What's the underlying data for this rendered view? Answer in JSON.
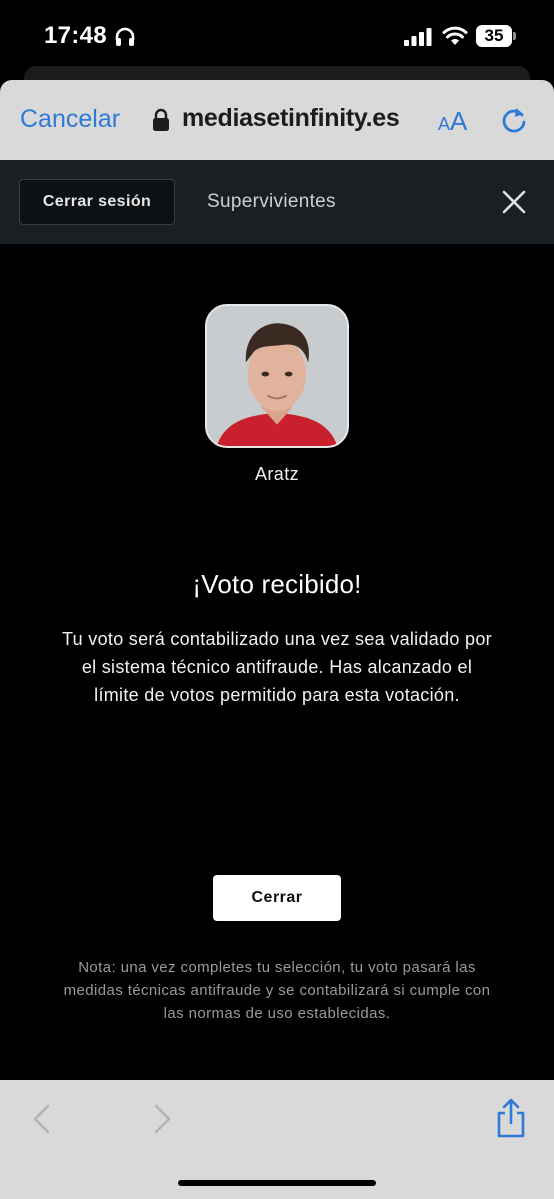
{
  "status_bar": {
    "time": "17:48",
    "battery": "35",
    "icons": [
      "headphones-icon",
      "cellular-signal-icon",
      "wifi-icon",
      "battery-icon"
    ]
  },
  "browser": {
    "cancel_label": "Cancelar",
    "url": "mediasetinfinity.es",
    "text_size_small": "A",
    "text_size_big": "A",
    "icons": [
      "lock-icon",
      "reload-icon",
      "back-icon",
      "forward-icon",
      "share-icon"
    ]
  },
  "topbar": {
    "logout_label": "Cerrar sesión",
    "title": "Supervivientes",
    "close_icon": "close-icon"
  },
  "content": {
    "candidate_name": "Aratz",
    "vote_title": "¡Voto recibido!",
    "vote_message": "Tu voto será contabilizado una vez sea validado por el sistema técnico antifraude. Has alcanzado el límite de votos permitido para esta votación.",
    "close_button": "Cerrar",
    "note": "Nota: una vez completes tu selección, tu voto pasará las medidas técnicas antifraude y se contabilizará si cumple con las normas de uso establecidas."
  },
  "colors": {
    "accent_blue": "#2f7ad6",
    "page_background": "#000000",
    "topbar_background": "#1a1f24",
    "browser_chrome": "#d9d9d9"
  }
}
